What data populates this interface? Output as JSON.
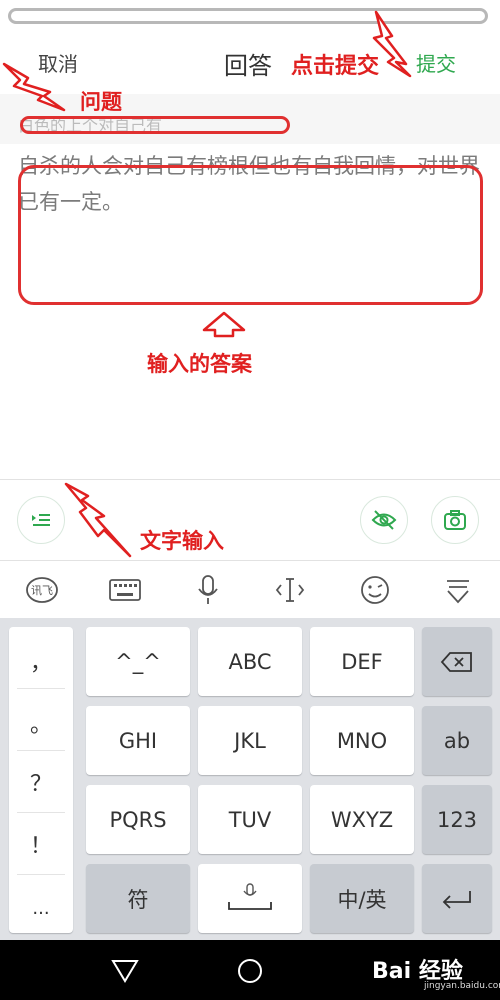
{
  "header": {
    "cancel_label": "取消",
    "title": "回答",
    "submit_label": "提交"
  },
  "question": {
    "text": "白色的上个对自己有"
  },
  "answer": {
    "text": "自杀的人会对自己有榜根但也有自我回情，对世界已有一定。"
  },
  "annotations": {
    "submit_note": "点击提交",
    "question_note": "问题",
    "answer_note": "输入的答案",
    "text_input_note": "文字输入"
  },
  "keyboard": {
    "punctuation": [
      "，",
      "。",
      "？",
      "！",
      "..."
    ],
    "rows": [
      [
        {
          "label": "^_^"
        },
        {
          "label": "ABC"
        },
        {
          "label": "DEF"
        },
        {
          "label": "⌫",
          "icon": "backspace-icon"
        }
      ],
      [
        {
          "label": "GHI"
        },
        {
          "label": "JKL"
        },
        {
          "label": "MNO"
        },
        {
          "label": "ab"
        }
      ],
      [
        {
          "label": "PQRS"
        },
        {
          "label": "TUV"
        },
        {
          "label": "WXYZ"
        },
        {
          "label": "123"
        }
      ],
      [
        {
          "label": "符"
        },
        {
          "label": "",
          "icon": "space-mic-icon"
        },
        {
          "label": "中/英"
        },
        {
          "label": "↵",
          "icon": "enter-icon"
        }
      ]
    ]
  },
  "watermark": {
    "text": "Bai 经验",
    "sub": "jingyan.baidu.com"
  },
  "colors": {
    "accent": "#2fa84f",
    "annotation": "#e02020",
    "keyboard_bg": "#dfe1e5"
  }
}
